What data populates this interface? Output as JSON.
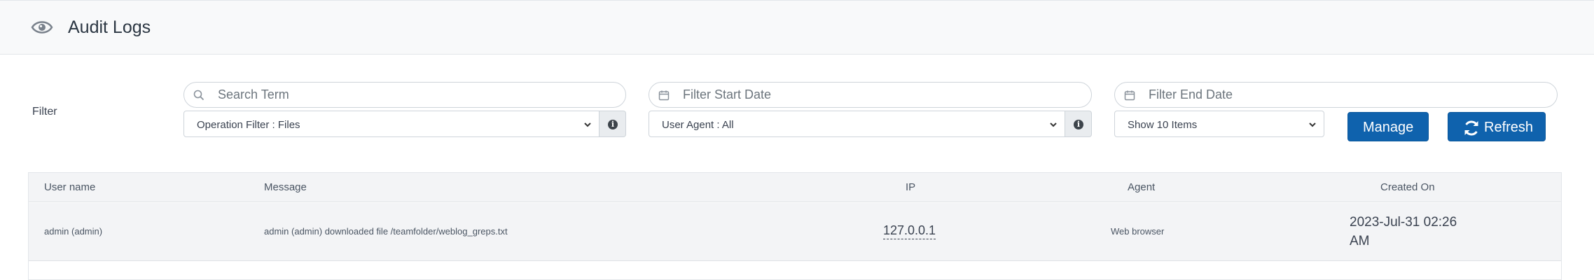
{
  "header": {
    "title": "Audit Logs",
    "icon": "eye-icon"
  },
  "filter": {
    "label": "Filter",
    "search_placeholder": "Search Term",
    "start_date_placeholder": "Filter Start Date",
    "end_date_placeholder": "Filter End Date",
    "operation_filter": "Operation Filter : Files",
    "user_agent_filter": "User Agent : All",
    "page_size": "Show 10 Items",
    "manage_label": "Manage",
    "refresh_label": "Refresh"
  },
  "table": {
    "columns": [
      "User name",
      "Message",
      "IP",
      "Agent",
      "Created On"
    ],
    "rows": [
      {
        "user": "admin (admin)",
        "message": "admin (admin) downloaded file /teamfolder/weblog_greps.txt",
        "ip": "127.0.0.1",
        "agent": "Web browser",
        "created": "2023-Jul-31 02:26 AM"
      }
    ]
  },
  "colors": {
    "accent": "#0f62ad",
    "header_bg": "#f8f9fa",
    "row_bg": "#f3f4f6"
  }
}
